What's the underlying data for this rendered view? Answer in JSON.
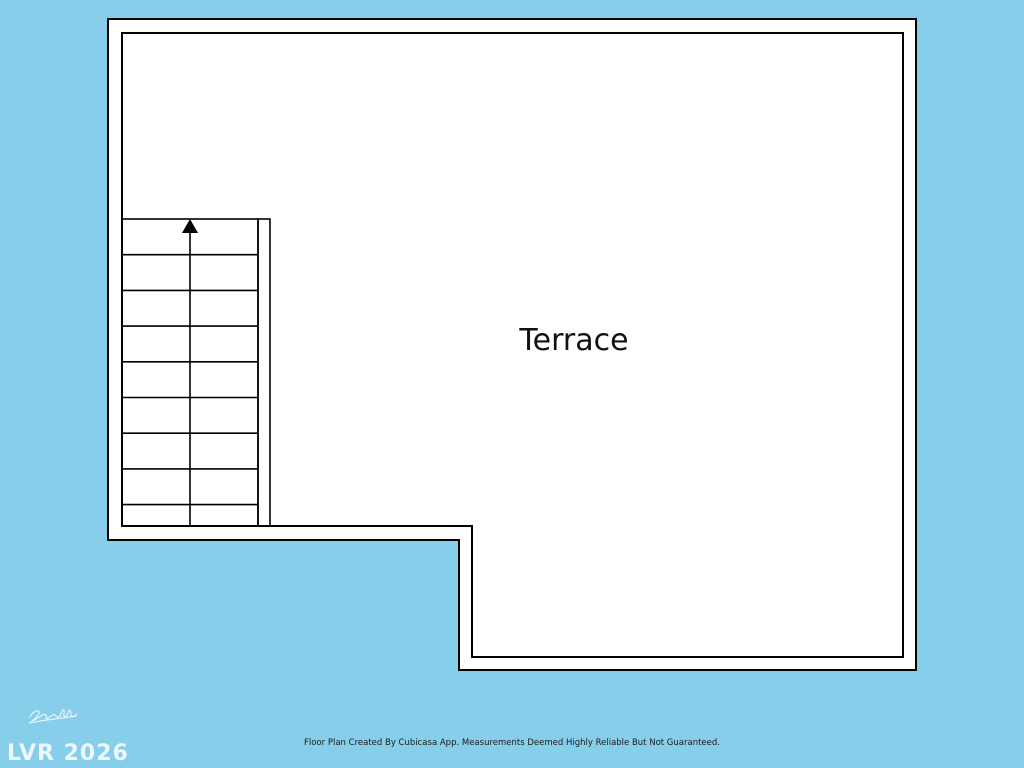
{
  "colors": {
    "background": "#87ceeb",
    "floor": "#ffffff",
    "wall": "#000000"
  },
  "plan": {
    "rooms": [
      {
        "name": "Terrace"
      }
    ],
    "stairs": {
      "direction": "up",
      "step_count": 9
    }
  },
  "footer": {
    "note": "Floor Plan Created By Cubicasa App. Measurements Deemed Highly Reliable But Not Guaranteed."
  },
  "watermark": {
    "text": "LVR 2026",
    "signature": "Sandra Mathe"
  }
}
